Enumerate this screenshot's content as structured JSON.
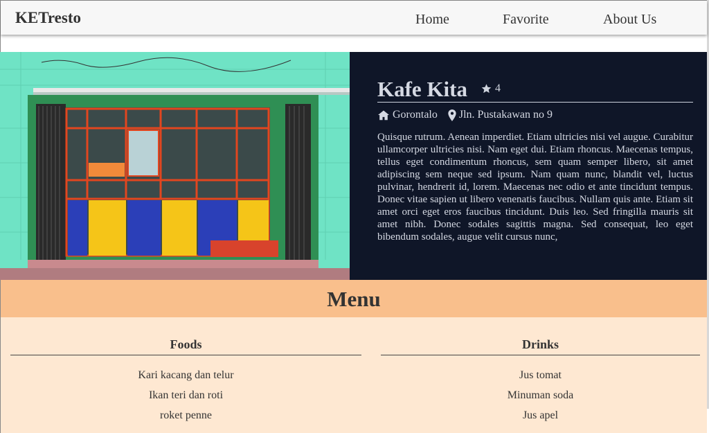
{
  "navbar": {
    "brand": "KETresto",
    "links": [
      "Home",
      "Favorite",
      "About Us"
    ]
  },
  "restaurant": {
    "name": "Kafe Kita",
    "rating": "4",
    "city": "Gorontalo",
    "address": "Jln. Pustakawan no 9",
    "description": "Quisque rutrum. Aenean imperdiet. Etiam ultricies nisi vel augue. Curabitur ullamcorper ultricies nisi. Nam eget dui. Etiam rhoncus. Maecenas tempus, tellus eget condimentum rhoncus, sem quam semper libero, sit amet adipiscing sem neque sed ipsum. Nam quam nunc, blandit vel, luctus pulvinar, hendrerit id, lorem. Maecenas nec odio et ante tincidunt tempus. Donec vitae sapien ut libero venenatis faucibus. Nullam quis ante. Etiam sit amet orci eget eros faucibus tincidunt. Duis leo. Sed fringilla mauris sit amet nibh. Donec sodales sagittis magna. Sed consequat, leo eget bibendum sodales, augue velit cursus nunc,"
  },
  "menu": {
    "title": "Menu",
    "foods": {
      "title": "Foods",
      "items": [
        "Kari kacang dan telur",
        "Ikan teri dan roti",
        "roket penne"
      ]
    },
    "drinks": {
      "title": "Drinks",
      "items": [
        "Jus tomat",
        "Minuman soda",
        "Jus apel"
      ]
    }
  },
  "colors": {
    "navbar_bg": "#f7f7f7",
    "detail_bg": "#0f1628",
    "menu_band": "#f9bf8c",
    "menu_body": "#fee8d2"
  },
  "icons": [
    "star-icon",
    "home-icon",
    "map-marker-icon"
  ]
}
